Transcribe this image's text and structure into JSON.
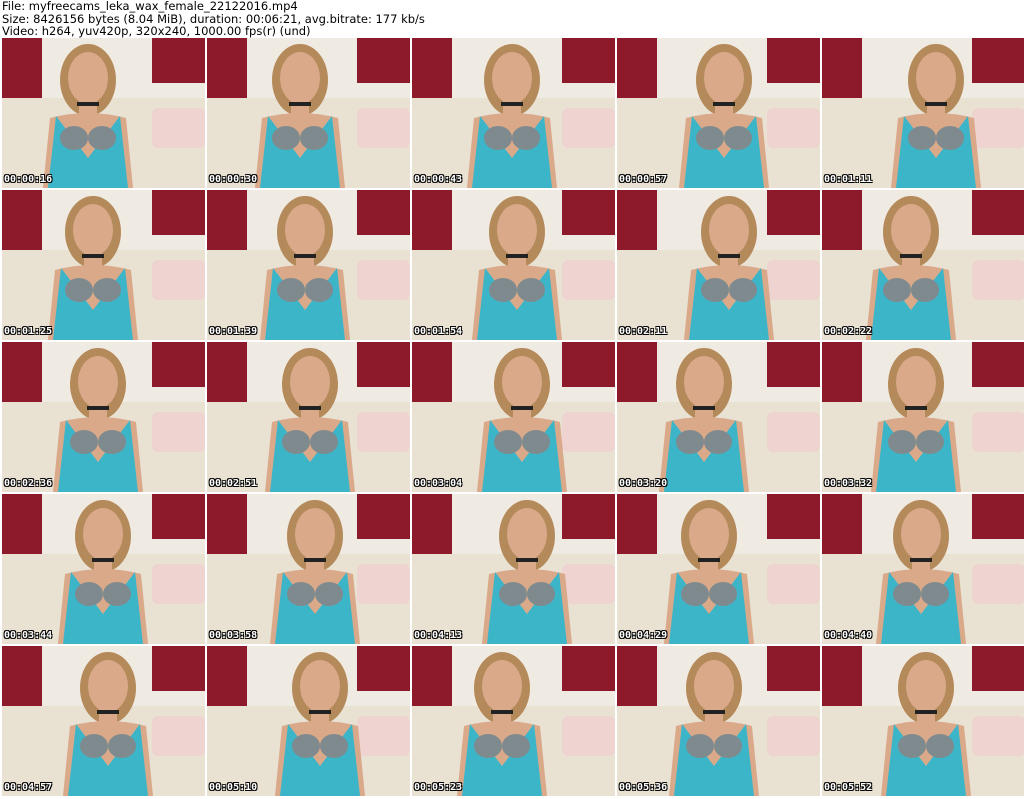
{
  "header": {
    "line1": "File: myfreecams_leka_wax_female_22122016.mp4",
    "line2": "Size: 8426156 bytes (8.04 MiB), duration: 00:06:21, avg.bitrate: 177 kb/s",
    "line3": "Video: h264, yuv420p, 320x240, 1000.00 fps(r) (und)"
  },
  "colors": {
    "wall": "#f0ebe2",
    "curtain": "#8c1a2a",
    "sofa": "#e9e2d3",
    "pillow": "#efd3d0",
    "skin": "#d9a98a",
    "hair": "#b48a5a",
    "dress": "#3cb5c9",
    "bra": "#7f8a8e"
  },
  "thumbnails": [
    {
      "timestamp": "00:00:16"
    },
    {
      "timestamp": "00:00:30"
    },
    {
      "timestamp": "00:00:43"
    },
    {
      "timestamp": "00:00:57"
    },
    {
      "timestamp": "00:01:11"
    },
    {
      "timestamp": "00:01:25"
    },
    {
      "timestamp": "00:01:39"
    },
    {
      "timestamp": "00:01:54"
    },
    {
      "timestamp": "00:02:11"
    },
    {
      "timestamp": "00:02:22"
    },
    {
      "timestamp": "00:02:36"
    },
    {
      "timestamp": "00:02:51"
    },
    {
      "timestamp": "00:03:04"
    },
    {
      "timestamp": "00:03:20"
    },
    {
      "timestamp": "00:03:32"
    },
    {
      "timestamp": "00:03:44"
    },
    {
      "timestamp": "00:03:58"
    },
    {
      "timestamp": "00:04:13"
    },
    {
      "timestamp": "00:04:29"
    },
    {
      "timestamp": "00:04:40"
    },
    {
      "timestamp": "00:04:57"
    },
    {
      "timestamp": "00:05:10"
    },
    {
      "timestamp": "00:05:23"
    },
    {
      "timestamp": "00:05:36"
    },
    {
      "timestamp": "00:05:52"
    }
  ]
}
